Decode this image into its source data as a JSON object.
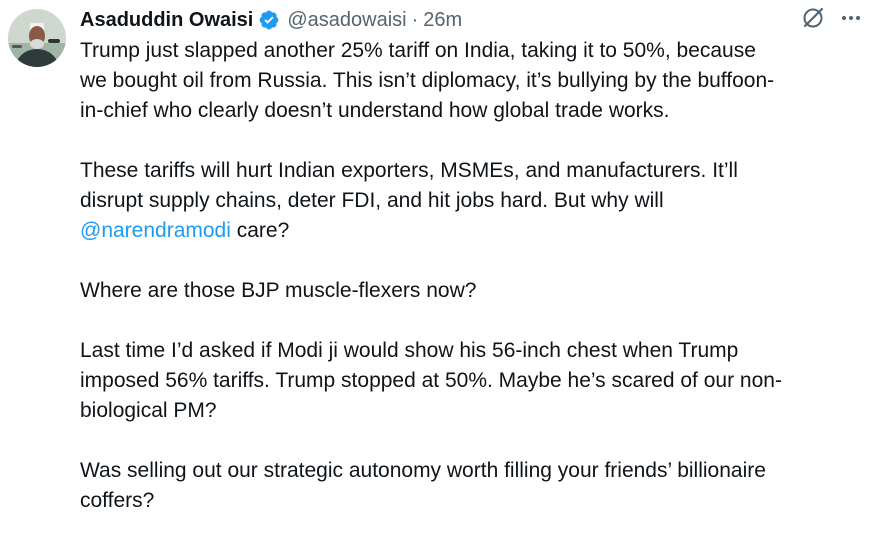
{
  "author": {
    "display_name": "Asaduddin Owaisi",
    "handle": "@asadowaisi",
    "separator": "·",
    "time": "26m",
    "verified": true,
    "verified_color": "#1d9bf0"
  },
  "actions": {
    "grok_icon": "grok-icon",
    "more_icon": "more-icon"
  },
  "post": {
    "p1_l1": "Trump just slapped another 25% tariff on India, taking it to 50%, because",
    "p1_l2": "we bought oil from Russia. This isn’t diplomacy, it’s bullying by the buffoon-",
    "p1_l3": "in-chief who clearly doesn’t understand how global trade works.",
    "p2_l1": "These tariffs will hurt Indian exporters, MSMEs, and manufacturers. It’ll",
    "p2_l2": "disrupt supply chains, deter FDI, and hit jobs hard. But why will",
    "p2_mention": "@narendramodi",
    "p2_after_mention": " care?",
    "p3_l1": "Where are those BJP muscle-flexers now?",
    "p4_l1": "Last time I’d asked if Modi ji would show his 56-inch chest when Trump",
    "p4_l2": "imposed 56% tariffs. Trump stopped at 50%. Maybe he’s scared of our non-",
    "p4_l3": "biological PM?",
    "p5_l1": "Was selling out our strategic autonomy worth filling your friends’ billionaire",
    "p5_l2": "coffers?"
  },
  "colors": {
    "text": "#0f1419",
    "muted": "#536471",
    "link": "#1d9bf0"
  }
}
